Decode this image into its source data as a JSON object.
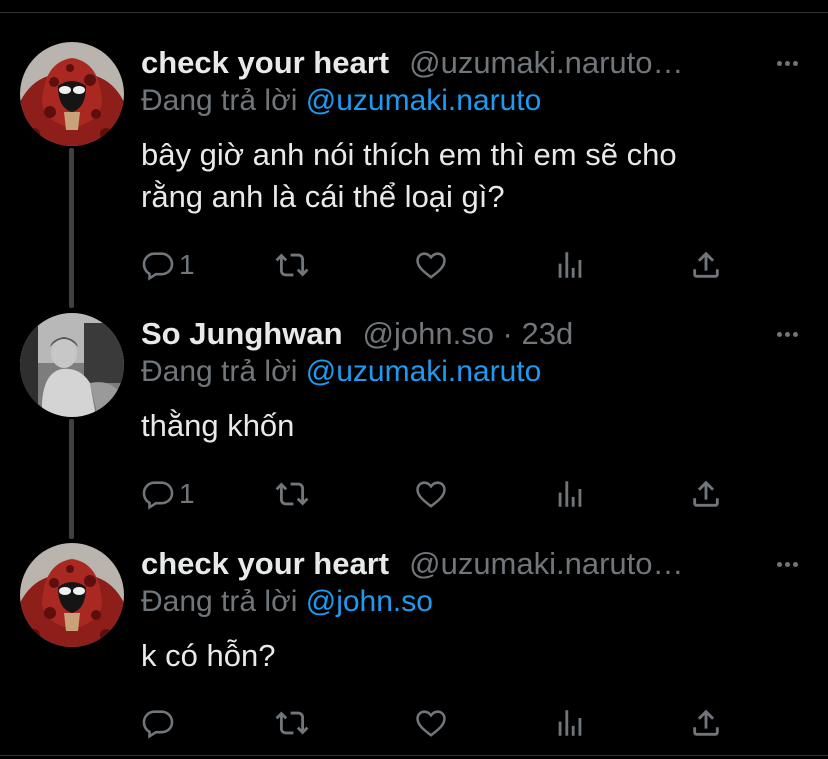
{
  "tweets": [
    {
      "name": "check your heart",
      "handle": "@uzumaki.naruto…",
      "reply_prefix": "Đang trả lời",
      "reply_to": "@uzumaki.naruto",
      "text_lines": [
        "bây giờ anh nói thích em thì em sẽ cho",
        "rằng anh là cái thể loại gì?"
      ],
      "reply_count": "1",
      "avatar": "red-hooded-avatar"
    },
    {
      "name": "So Junghwan",
      "handle": "@john.so · 23d",
      "reply_prefix": "Đang trả lời",
      "reply_to": "@uzumaki.naruto",
      "text_lines": [
        "thằng khốn"
      ],
      "reply_count": "1",
      "avatar": "grayscale-photo-avatar"
    },
    {
      "name": "check your heart",
      "handle": "@uzumaki.naruto…",
      "reply_prefix": "Đang trả lời",
      "reply_to": "@john.so",
      "text_lines": [
        "k có hỗn?"
      ],
      "reply_count": "",
      "avatar": "red-hooded-avatar"
    }
  ],
  "icons": {
    "reply": "reply-icon",
    "retweet": "retweet-icon",
    "like": "heart-icon",
    "views": "views-icon",
    "share": "share-icon",
    "more": "more-icon"
  },
  "colors": {
    "background": "#000000",
    "text": "#e7e9ea",
    "muted": "#71767b",
    "link": "#1d9bf0"
  }
}
